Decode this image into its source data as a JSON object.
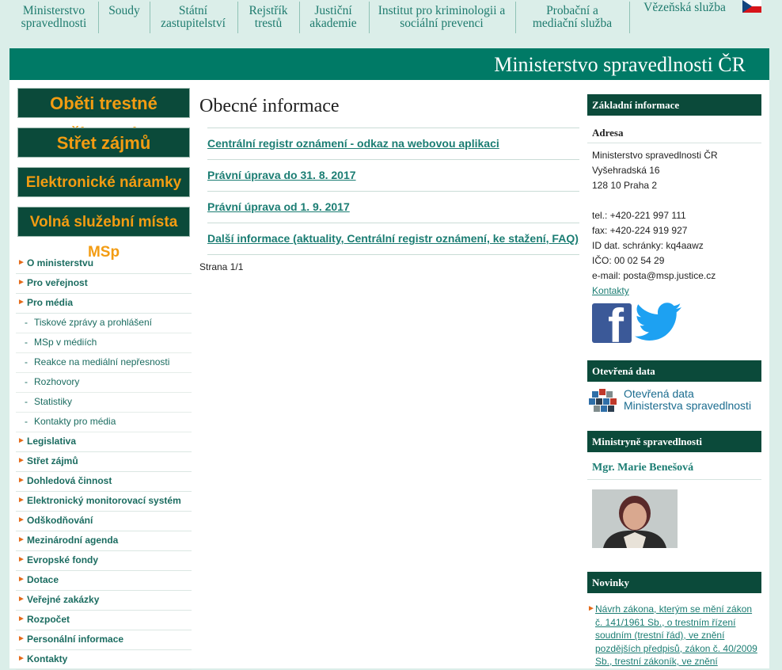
{
  "topnav": {
    "items": [
      "Ministerstvo spravedlnosti",
      "Soudy",
      "Státní zastupitelství",
      "Rejstřík trestů",
      "Justiční akademie",
      "Institut pro kriminologii a sociální prevenci",
      "Probační a mediační služba",
      "Vězeňská služba"
    ]
  },
  "banner": {
    "title": "Ministerstvo spravedlnosti ČR"
  },
  "promos": [
    "Oběti trestné činnosti",
    "Střet zájmů",
    "Elektronické náramky",
    "Volná služební místa MSp"
  ],
  "left_menu": [
    {
      "label": "O ministerstvu",
      "type": "main"
    },
    {
      "label": "Pro veřejnost",
      "type": "main"
    },
    {
      "label": "Pro média",
      "type": "main"
    },
    {
      "label": "Tiskové zprávy a prohlášení",
      "type": "sub"
    },
    {
      "label": "MSp v médiích",
      "type": "sub"
    },
    {
      "label": "Reakce na mediální nepřesnosti",
      "type": "sub"
    },
    {
      "label": "Rozhovory",
      "type": "sub"
    },
    {
      "label": "Statistiky",
      "type": "sub"
    },
    {
      "label": "Kontakty pro média",
      "type": "sub"
    },
    {
      "label": "Legislativa",
      "type": "main"
    },
    {
      "label": "Střet zájmů",
      "type": "main"
    },
    {
      "label": "Dohledová činnost",
      "type": "main"
    },
    {
      "label": "Elektronický monitorovací systém",
      "type": "main"
    },
    {
      "label": "Odškodňování",
      "type": "main"
    },
    {
      "label": "Mezinárodní agenda",
      "type": "main"
    },
    {
      "label": "Evropské fondy",
      "type": "main"
    },
    {
      "label": "Dotace",
      "type": "main"
    },
    {
      "label": "Veřejné zakázky",
      "type": "main"
    },
    {
      "label": "Rozpočet",
      "type": "main"
    },
    {
      "label": "Personální informace",
      "type": "main"
    },
    {
      "label": "Kontakty",
      "type": "main"
    }
  ],
  "main": {
    "title": "Obecné informace",
    "links": [
      "Centrální registr oznámení - odkaz na webovou aplikaci",
      "Právní úprava do 31. 8. 2017",
      "Právní úprava od 1. 9. 2017",
      "Další informace (aktuality, Centrální registr oznámení, ke stažení, FAQ)"
    ],
    "pagination": "Strana 1/1"
  },
  "right": {
    "basic_heading": "Základní informace",
    "address_heading": "Adresa",
    "address_lines": [
      "Ministerstvo spravedlnosti ČR",
      "Vyšehradská 16",
      "128 10 Praha 2"
    ],
    "contact_lines": [
      "tel.: +420-221 997 111",
      "fax: +420-224 919 927",
      "ID dat. schránky: kq4aawz",
      "IČO: 00 02 54 29",
      "e-mail: posta@msp.justice.cz"
    ],
    "contacts_link": "Kontakty",
    "open_data_heading": "Otevřená data",
    "open_data_line1": "Otevřená data",
    "open_data_line2": "Ministerstva spravedlnosti",
    "minister_heading": "Ministryně spravedlnosti",
    "minister_name": "Mgr. Marie Benešová",
    "news_heading": "Novinky",
    "news_item": "Návrh zákona, kterým se mění zákon č. 141/1961 Sb., o trestním řízení soudním (trestní řád), ve znění pozdějších předpisů, zákon č. 40/2009 Sb., trestní zákoník, ve znění"
  },
  "colors": {
    "accent": "#007a66",
    "dark": "#0b4a3a",
    "orange": "#f39c12",
    "link": "#1b7d73"
  }
}
